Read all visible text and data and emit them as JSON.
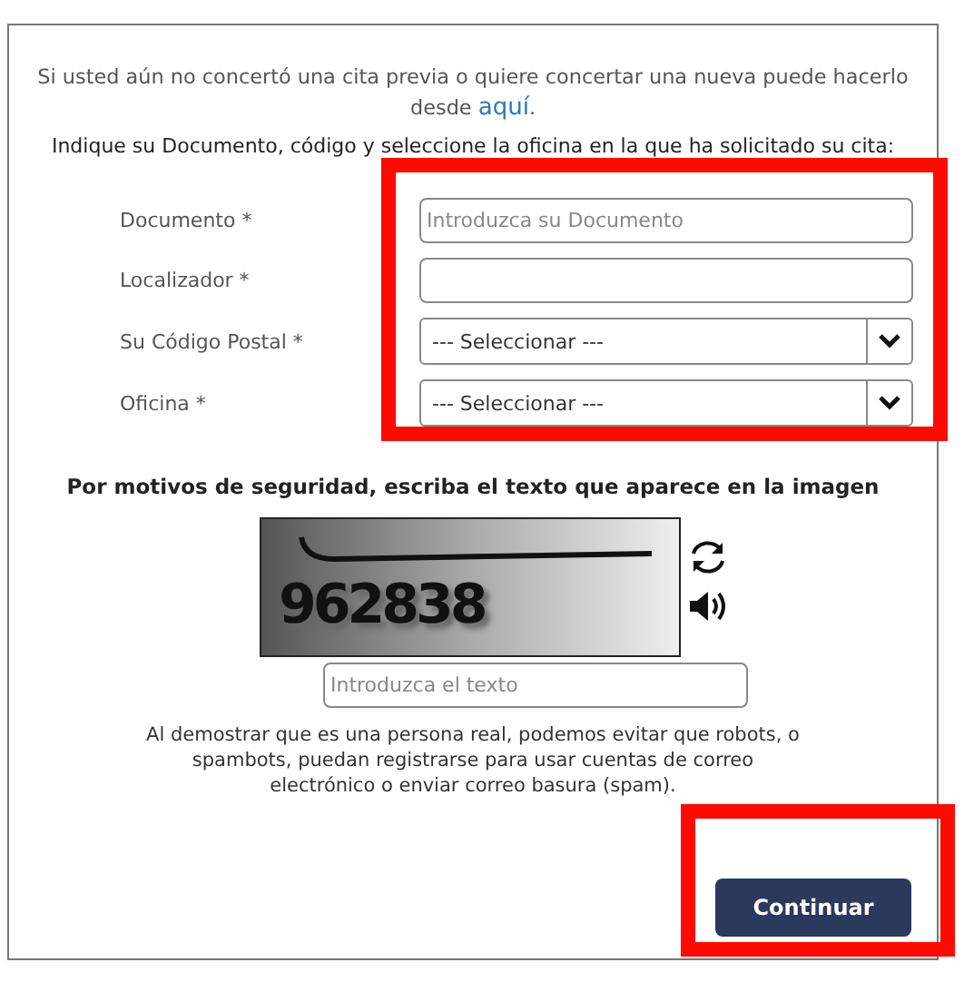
{
  "intro": {
    "text": "Si usted aún no concertó una cita previa o quiere concertar una nueva puede hacerlo desde",
    "link": "aquí",
    "after": "."
  },
  "instruction": "Indique su Documento, código y seleccione la oficina en la que ha solicitado su cita:",
  "fields": [
    {
      "kind": "text",
      "label": "Documento *",
      "placeholder": "Introduzca su Documento"
    },
    {
      "kind": "text",
      "label": "Localizador *"
    },
    {
      "kind": "select",
      "label": "Su Código Postal *",
      "value": "--- Seleccionar ---"
    },
    {
      "kind": "select",
      "label": "Oficina *",
      "value": "--- Seleccionar ---"
    }
  ],
  "security_heading": "Por motivos de seguridad, escriba el texto que aparece en la imagen",
  "captcha": {
    "text": "962838",
    "placeholder": "Introduzca el texto"
  },
  "disclaimer": "Al demostrar que es una persona real, podemos evitar que robots, o spambots, puedan registrarse para usar cuentas de correo electrónico o enviar correo basura (spam).",
  "submit": "Continuar"
}
